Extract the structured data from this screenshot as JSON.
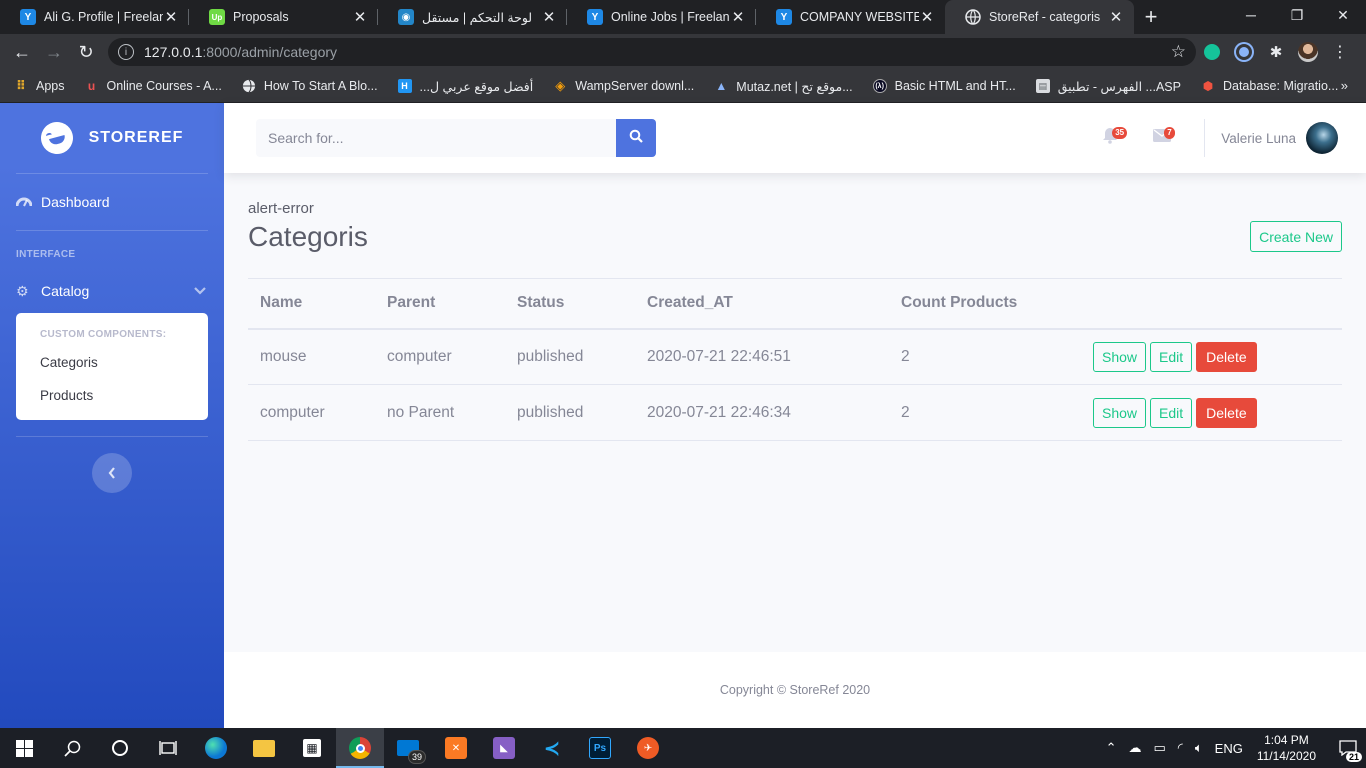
{
  "browser": {
    "tabs": [
      {
        "title": "Ali G. Profile | Freelancer",
        "icon": "freelancer-icon",
        "color": "#1e88e5"
      },
      {
        "title": "Proposals",
        "icon": "upwork-icon",
        "color": "#6fda44"
      },
      {
        "title": "لوحة التحكم | مستقل",
        "icon": "mostaql-icon",
        "color": "#2386c8"
      },
      {
        "title": "Online Jobs | Freelancer",
        "icon": "freelancer-icon",
        "color": "#1e88e5"
      },
      {
        "title": "COMPANY WEBSITE | Freelancer",
        "icon": "freelancer-icon",
        "color": "#1e88e5"
      },
      {
        "title": "StoreRef - categoris",
        "icon": "globe-icon",
        "color": "#9aa0a6"
      }
    ],
    "url_host": "127.0.0.1",
    "url_path": ":8000/admin/category",
    "bookmarks": [
      {
        "label": "Apps",
        "icon": "apps-grid-icon",
        "color": "#e0a72b"
      },
      {
        "label": "Online Courses - A...",
        "icon": "udemy-icon",
        "color": "#ec5252"
      },
      {
        "label": "How To Start A Blo...",
        "icon": "globe-icon",
        "color": "#9aa0a6"
      },
      {
        "label": "أفضل موقع عربي ل...",
        "icon": "hsoub-icon",
        "color": "#2196f3"
      },
      {
        "label": "WampServer downl...",
        "icon": "wamp-icon",
        "color": "#f59e0b"
      },
      {
        "label": "Mutaz.net | موقع تح...",
        "icon": "mutaz-icon",
        "color": "#4b8ec8"
      },
      {
        "label": "Basic HTML and HT...",
        "icon": "freecodecamp-icon",
        "color": "#0a0a23"
      },
      {
        "label": "الفهرس - تطبيق ...ASP",
        "icon": "doc-icon",
        "color": "#dadce0"
      },
      {
        "label": "Database: Migratio...",
        "icon": "laravel-icon",
        "color": "#f05340"
      }
    ]
  },
  "sidebar": {
    "brand": "STOREREF",
    "dashboard": "Dashboard",
    "heading_interface": "INTERFACE",
    "catalog": "Catalog",
    "collapse_heading": "CUSTOM COMPONENTS:",
    "collapse_items": [
      "Categoris",
      "Products"
    ]
  },
  "topbar": {
    "search_placeholder": "Search for...",
    "alerts_count": "35",
    "messages_count": "7",
    "user_name": "Valerie Luna"
  },
  "main": {
    "alert_text": "alert-error",
    "title": "Categoris",
    "create_button": "Create New",
    "columns": [
      "Name",
      "Parent",
      "Status",
      "Created_AT",
      "Count Products",
      ""
    ],
    "rows": [
      {
        "name": "mouse",
        "parent": "computer",
        "status": "published",
        "created_at": "2020-07-21 22:46:51",
        "count": "2"
      },
      {
        "name": "computer",
        "parent": "no Parent",
        "status": "published",
        "created_at": "2020-07-21 22:46:34",
        "count": "2"
      }
    ],
    "actions": {
      "show": "Show",
      "edit": "Edit",
      "delete": "Delete"
    }
  },
  "footer": {
    "copyright": "Copyright © StoreRef 2020"
  },
  "taskbar": {
    "mail_count": "39",
    "lang": "ENG",
    "time": "1:04 PM",
    "date": "11/14/2020",
    "notifications": "21"
  },
  "colors": {
    "primary": "#4e73df",
    "success": "#1cc88a",
    "danger": "#e74a3b"
  }
}
